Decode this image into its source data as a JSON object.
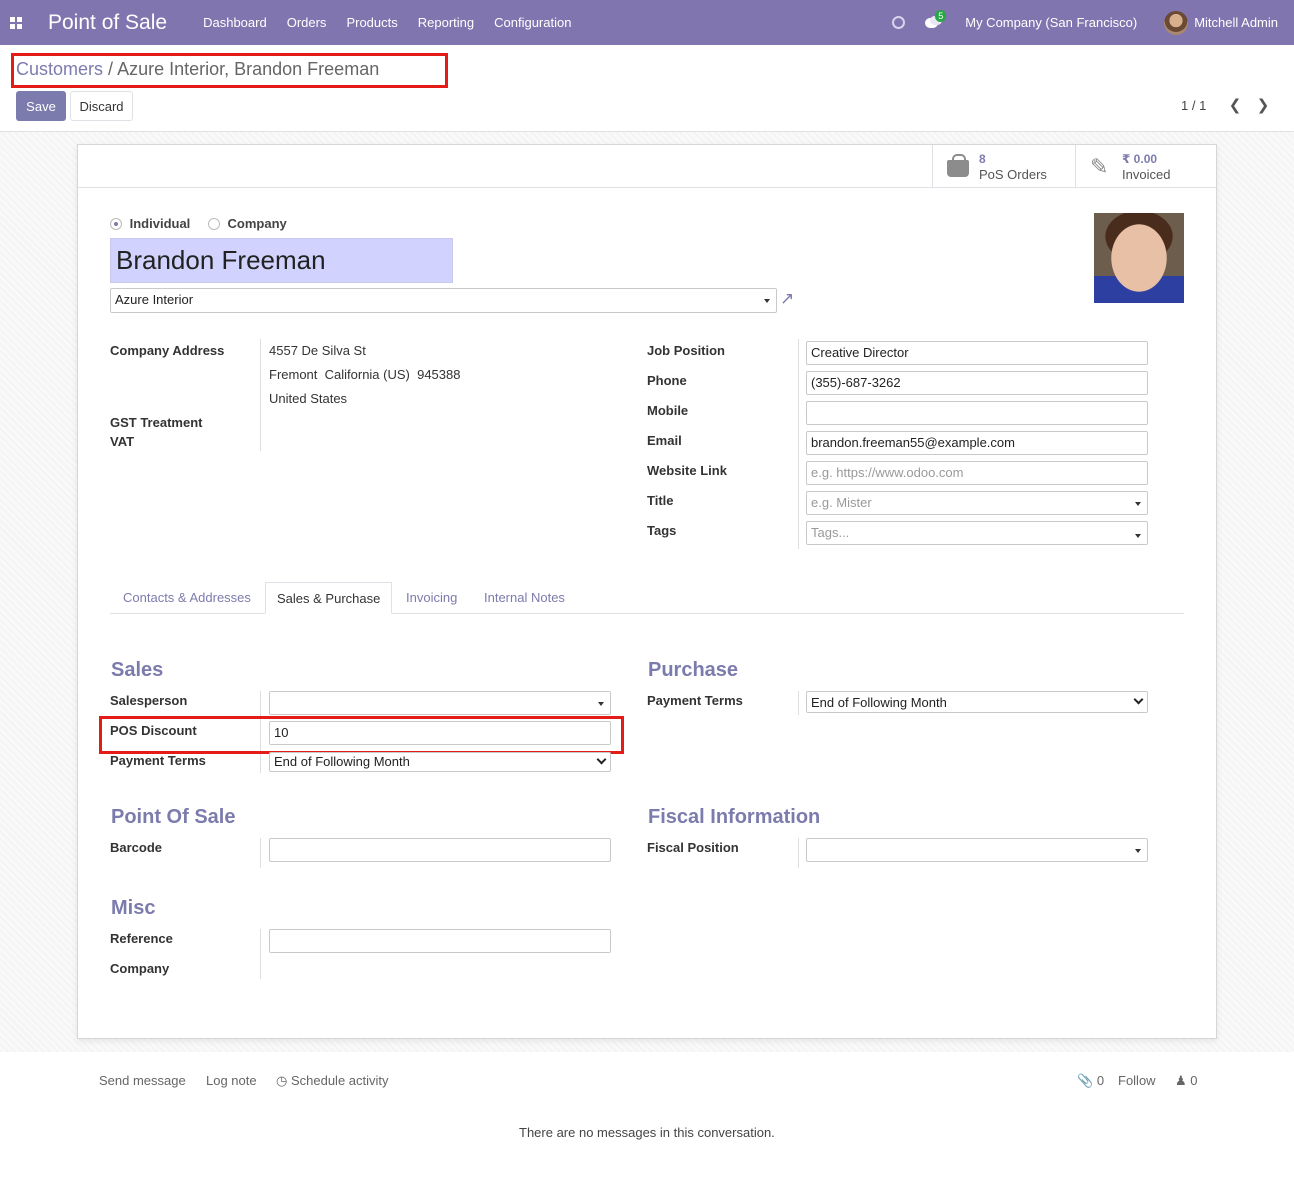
{
  "nav": {
    "app_title": "Point of Sale",
    "menu": [
      "Dashboard",
      "Orders",
      "Products",
      "Reporting",
      "Configuration"
    ],
    "chat_count": "5",
    "company": "My Company (San Francisco)",
    "user": "Mitchell Admin"
  },
  "control": {
    "breadcrumb_parent": "Customers",
    "breadcrumb_sep": "/",
    "breadcrumb_current": "Azure Interior, Brandon Freeman",
    "save": "Save",
    "discard": "Discard",
    "pager": "1 / 1"
  },
  "smart_buttons": {
    "pos_orders_count": "8",
    "pos_orders_label": "PoS Orders",
    "invoiced_amount": "₹ 0.00",
    "invoiced_label": "Invoiced"
  },
  "partner": {
    "type_individual": "Individual",
    "type_company": "Company",
    "selected_type": "Individual",
    "name": "Brandon Freeman",
    "parent_company": "Azure Interior"
  },
  "left_fields": {
    "company_address_label": "Company Address",
    "address_line1": "4557 De Silva St",
    "address_line2": "Fremont  California (US)  945388",
    "address_line3": "United States",
    "gst_label": "GST Treatment",
    "vat_label": "VAT"
  },
  "right_fields": {
    "job_position_label": "Job Position",
    "job_position": "Creative Director",
    "phone_label": "Phone",
    "phone": "(355)-687-3262",
    "mobile_label": "Mobile",
    "mobile": "",
    "email_label": "Email",
    "email": "brandon.freeman55@example.com",
    "website_label": "Website Link",
    "website_placeholder": "e.g. https://www.odoo.com",
    "title_label": "Title",
    "title_placeholder": "e.g. Mister",
    "tags_label": "Tags",
    "tags_placeholder": "Tags..."
  },
  "tabs": [
    "Contacts & Addresses",
    "Sales & Purchase",
    "Invoicing",
    "Internal Notes"
  ],
  "active_tab": "Sales & Purchase",
  "sales": {
    "heading": "Sales",
    "salesperson_label": "Salesperson",
    "salesperson": "",
    "pos_discount_label": "POS Discount",
    "pos_discount": "10",
    "payment_terms_label": "Payment Terms",
    "payment_terms": "End of Following Month"
  },
  "purchase": {
    "heading": "Purchase",
    "payment_terms_label": "Payment Terms",
    "payment_terms": "End of Following Month"
  },
  "pos": {
    "heading": "Point Of Sale",
    "barcode_label": "Barcode",
    "barcode": ""
  },
  "fiscal": {
    "heading": "Fiscal Information",
    "fiscal_position_label": "Fiscal Position",
    "fiscal_position": ""
  },
  "misc": {
    "heading": "Misc",
    "reference_label": "Reference",
    "reference": "",
    "company_label": "Company"
  },
  "chatter": {
    "send_message": "Send message",
    "log_note": "Log note",
    "schedule_activity": "Schedule activity",
    "attachments_count": "0",
    "follow": "Follow",
    "followers_count": "0",
    "empty_message": "There are no messages in this conversation."
  },
  "colors": {
    "brand": "#8075af",
    "accent": "#7c7bad",
    "highlight_box": "#e41b17",
    "name_field_bg": "#d2d2ff"
  }
}
